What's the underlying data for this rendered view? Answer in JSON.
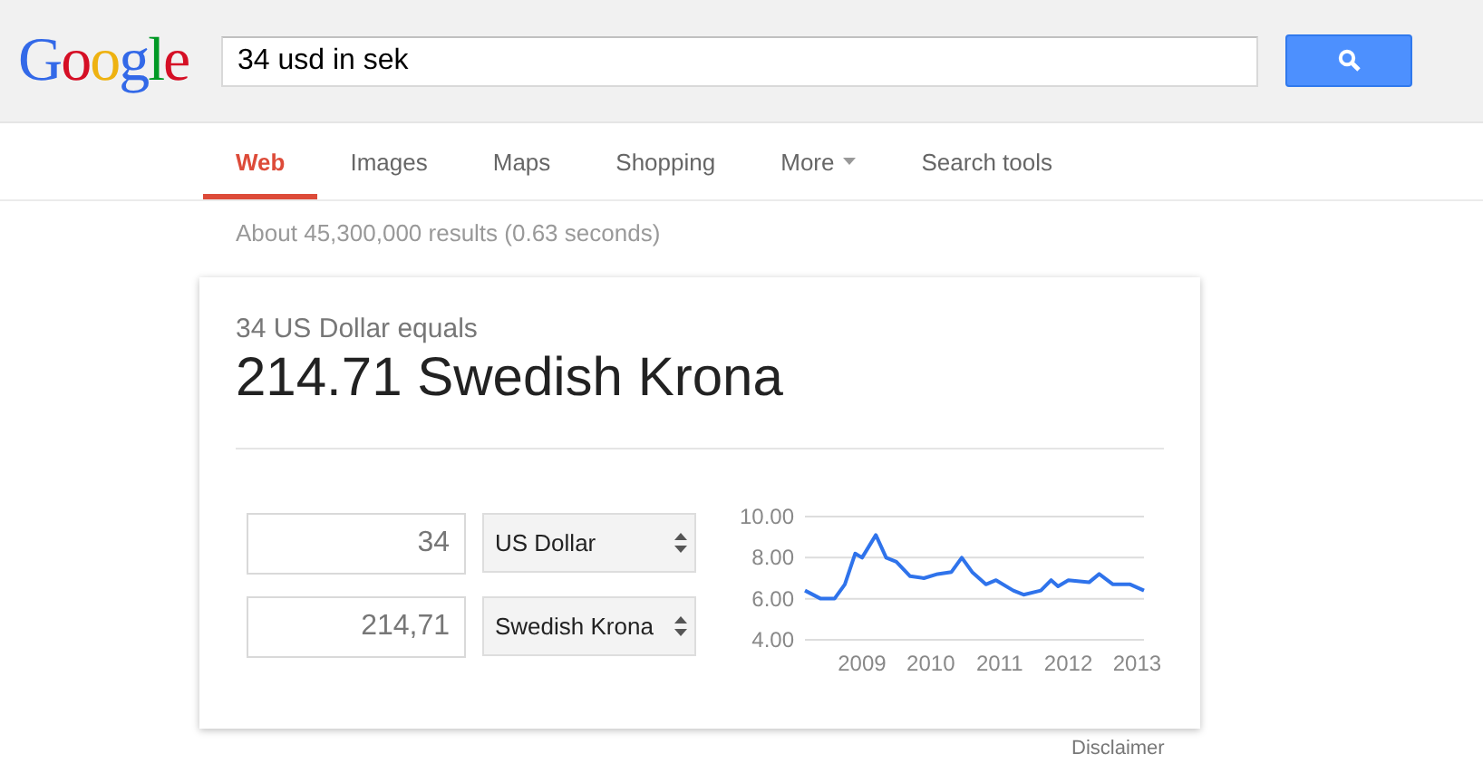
{
  "logo": "Google",
  "search": {
    "value": "34 usd in sek"
  },
  "tabs": [
    {
      "label": "Web",
      "selected": true,
      "kind": "tab"
    },
    {
      "label": "Images",
      "selected": false,
      "kind": "tab"
    },
    {
      "label": "Maps",
      "selected": false,
      "kind": "tab"
    },
    {
      "label": "Shopping",
      "selected": false,
      "kind": "tab"
    },
    {
      "label": "More",
      "selected": false,
      "kind": "menu"
    },
    {
      "label": "Search tools",
      "selected": false,
      "kind": "tab"
    }
  ],
  "result_stats": "About 45,300,000 results (0.63 seconds)",
  "converter": {
    "equals": "34 US Dollar equals",
    "result": "214.71 Swedish Krona",
    "rows": [
      {
        "amount": "34",
        "currency": "US Dollar"
      },
      {
        "amount": "214,71",
        "currency": "Swedish Krona"
      }
    ],
    "chart_data": {
      "type": "line",
      "xlim": [
        2008.17,
        2013.1
      ],
      "ylim": [
        4,
        10
      ],
      "xticks": [
        2009,
        2010,
        2011,
        2012,
        2013
      ],
      "yticks": [
        {
          "value": 4,
          "label": "4.00"
        },
        {
          "value": 6,
          "label": "6.00"
        },
        {
          "value": 8,
          "label": "8.00"
        },
        {
          "value": 10,
          "label": "10.00"
        }
      ],
      "x": [
        2008.17,
        2008.4,
        2008.6,
        2008.75,
        2008.9,
        2009.0,
        2009.2,
        2009.35,
        2009.5,
        2009.7,
        2009.9,
        2010.1,
        2010.3,
        2010.45,
        2010.6,
        2010.8,
        2010.95,
        2011.2,
        2011.35,
        2011.6,
        2011.75,
        2011.85,
        2012.0,
        2012.3,
        2012.45,
        2012.65,
        2012.9,
        2013.1
      ],
      "series": [
        {
          "color": "#2f73eb",
          "values": [
            6.4,
            6.0,
            6.0,
            6.7,
            8.2,
            8.0,
            9.1,
            8.0,
            7.8,
            7.1,
            7.0,
            7.2,
            7.3,
            8.0,
            7.3,
            6.7,
            6.9,
            6.4,
            6.2,
            6.4,
            6.9,
            6.6,
            6.9,
            6.8,
            7.2,
            6.7,
            6.7,
            6.4
          ]
        }
      ]
    }
  },
  "disclaimer": "Disclaimer"
}
